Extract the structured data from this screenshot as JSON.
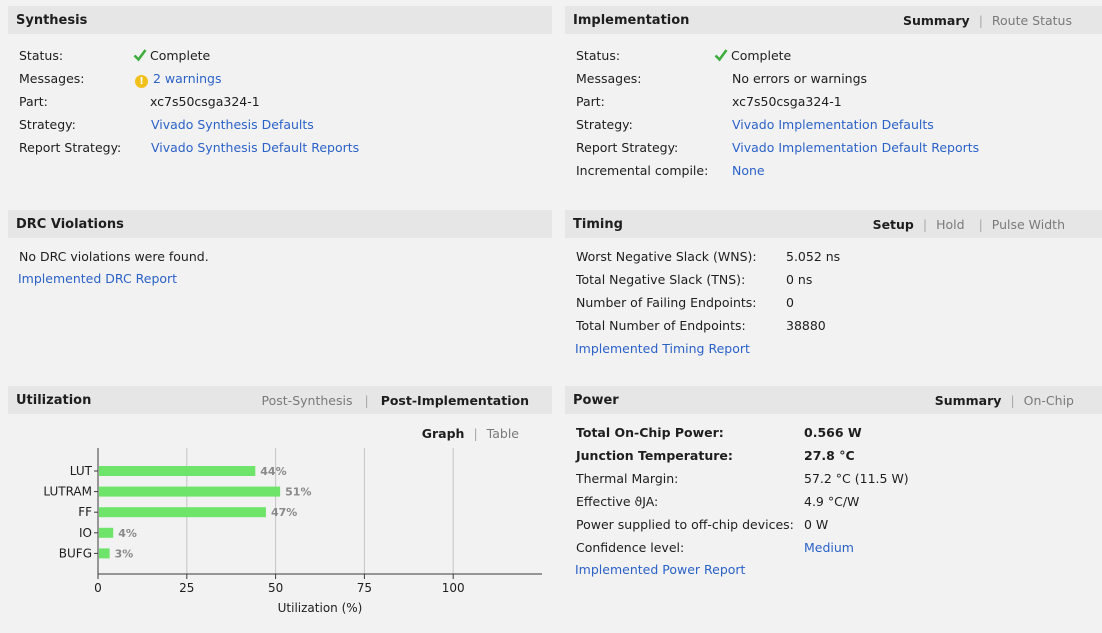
{
  "synthesis": {
    "title": "Synthesis",
    "rows": [
      {
        "label": "Status:",
        "value": "Complete"
      },
      {
        "label": "Messages:",
        "value": "2 warnings"
      },
      {
        "label": "Part:",
        "value": "xc7s50csga324-1"
      },
      {
        "label": "Strategy:",
        "value": "Vivado Synthesis Defaults"
      },
      {
        "label": "Report Strategy:",
        "value": "Vivado Synthesis Default Reports"
      }
    ]
  },
  "implementation": {
    "title": "Implementation",
    "tabs": [
      "Summary",
      "Route Status"
    ],
    "rows": [
      {
        "label": "Status:",
        "value": "Complete"
      },
      {
        "label": "Messages:",
        "value": "No errors or warnings"
      },
      {
        "label": "Part:",
        "value": "xc7s50csga324-1"
      },
      {
        "label": "Strategy:",
        "value": "Vivado Implementation Defaults"
      },
      {
        "label": "Report Strategy:",
        "value": "Vivado Implementation Default Reports"
      },
      {
        "label": "Incremental compile:",
        "value": "None"
      }
    ]
  },
  "drc": {
    "title": "DRC Violations",
    "message": "No DRC violations were found.",
    "link": "Implemented DRC Report"
  },
  "timing": {
    "title": "Timing",
    "tabs": [
      "Setup",
      "Hold",
      "Pulse Width"
    ],
    "rows": [
      {
        "label": "Worst Negative Slack (WNS):",
        "value": "5.052 ns"
      },
      {
        "label": "Total Negative Slack (TNS):",
        "value": "0 ns"
      },
      {
        "label": "Number of Failing Endpoints:",
        "value": "0"
      },
      {
        "label": "Total Number of Endpoints:",
        "value": "38880"
      }
    ],
    "link": "Implemented Timing Report"
  },
  "utilization": {
    "title": "Utilization",
    "tabs": [
      "Post-Synthesis",
      "Post-Implementation"
    ],
    "view_tabs": [
      "Graph",
      "Table"
    ]
  },
  "power": {
    "title": "Power",
    "tabs": [
      "Summary",
      "On-Chip"
    ],
    "rows": [
      {
        "label": "Total On-Chip Power:",
        "value": "0.566 W"
      },
      {
        "label": "Junction Temperature:",
        "value": "27.8 °C"
      },
      {
        "label": "Thermal Margin:",
        "value": "57.2 °C (11.5 W)"
      },
      {
        "label": "Effective ϑJA:",
        "value": "4.9 °C/W"
      },
      {
        "label": "Power supplied to off-chip devices:",
        "value": "0 W"
      },
      {
        "label": "Confidence level:",
        "value": "Medium"
      }
    ],
    "link": "Implemented Power Report"
  },
  "colors": {
    "bar": "#6ee46b",
    "link": "#2b62c8",
    "check": "#3fae3f",
    "warning": "#f2c01b"
  },
  "chart_data": {
    "type": "bar",
    "orientation": "horizontal",
    "categories": [
      "LUT",
      "LUTRAM",
      "FF",
      "IO",
      "BUFG"
    ],
    "values": [
      44,
      51,
      47,
      4,
      3
    ],
    "value_labels": [
      "44%",
      "51%",
      "47%",
      "4%",
      "3%"
    ],
    "xlabel": "Utilization (%)",
    "ylabel": "",
    "xlim": [
      0,
      125
    ],
    "xticks": [
      0,
      25,
      50,
      75,
      100
    ],
    "grid": true
  }
}
